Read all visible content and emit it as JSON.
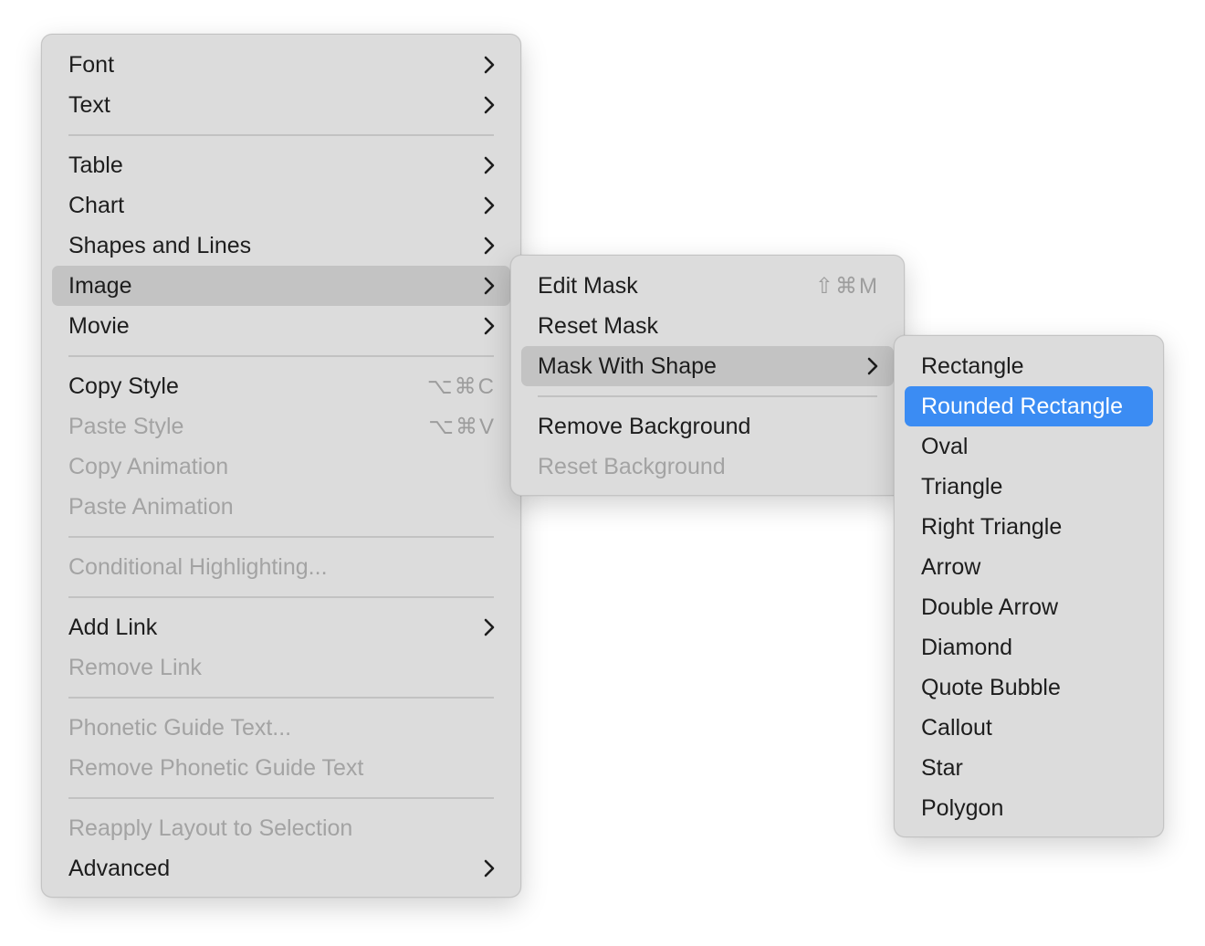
{
  "main_menu": {
    "items": [
      {
        "label": "Font",
        "submenu": true,
        "enabled": true
      },
      {
        "label": "Text",
        "submenu": true,
        "enabled": true
      },
      {
        "label": "Table",
        "submenu": true,
        "enabled": true
      },
      {
        "label": "Chart",
        "submenu": true,
        "enabled": true
      },
      {
        "label": "Shapes and Lines",
        "submenu": true,
        "enabled": true
      },
      {
        "label": "Image",
        "submenu": true,
        "enabled": true,
        "highlighted": true
      },
      {
        "label": "Movie",
        "submenu": true,
        "enabled": true
      },
      {
        "label": "Copy Style",
        "shortcut": "⌥⌘C",
        "enabled": true
      },
      {
        "label": "Paste Style",
        "shortcut": "⌥⌘V",
        "enabled": false
      },
      {
        "label": "Copy Animation",
        "enabled": false
      },
      {
        "label": "Paste Animation",
        "enabled": false
      },
      {
        "label": "Conditional Highlighting...",
        "enabled": false
      },
      {
        "label": "Add Link",
        "submenu": true,
        "enabled": true
      },
      {
        "label": "Remove Link",
        "enabled": false
      },
      {
        "label": "Phonetic Guide Text...",
        "enabled": false
      },
      {
        "label": "Remove Phonetic Guide Text",
        "enabled": false
      },
      {
        "label": "Reapply Layout to Selection",
        "enabled": false
      },
      {
        "label": "Advanced",
        "submenu": true,
        "enabled": true
      }
    ]
  },
  "image_menu": {
    "items": [
      {
        "label": "Edit Mask",
        "shortcut": "⇧⌘M",
        "enabled": true
      },
      {
        "label": "Reset Mask",
        "enabled": true
      },
      {
        "label": "Mask With Shape",
        "submenu": true,
        "enabled": true,
        "highlighted": true
      },
      {
        "label": "Remove Background",
        "enabled": true
      },
      {
        "label": "Reset Background",
        "enabled": false
      }
    ]
  },
  "shape_menu": {
    "items": [
      {
        "label": "Rectangle"
      },
      {
        "label": "Rounded Rectangle",
        "selected": true
      },
      {
        "label": "Oval"
      },
      {
        "label": "Triangle"
      },
      {
        "label": "Right Triangle"
      },
      {
        "label": "Arrow"
      },
      {
        "label": "Double Arrow"
      },
      {
        "label": "Diamond"
      },
      {
        "label": "Quote Bubble"
      },
      {
        "label": "Callout"
      },
      {
        "label": "Star"
      },
      {
        "label": "Polygon"
      }
    ]
  },
  "icons": {
    "submenu_indicator": "chevron-right-icon"
  },
  "colors": {
    "menu_background": "#dcdcdc",
    "hover_background": "#c3c3c3",
    "selection_accent": "#3b8cf3",
    "disabled_text": "#a3a3a3",
    "text": "#1d1d1d"
  }
}
